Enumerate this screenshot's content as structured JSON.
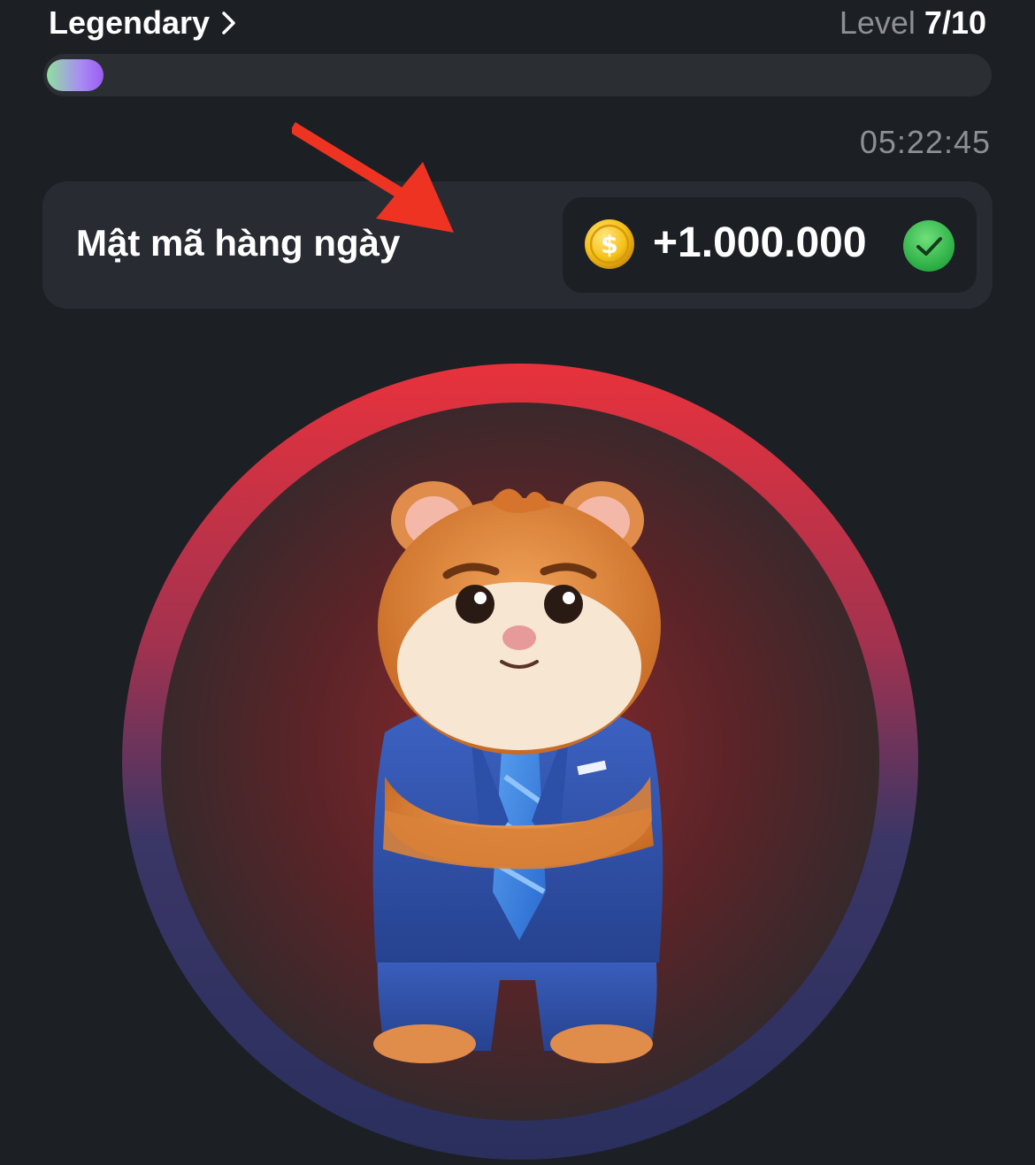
{
  "header": {
    "league": "Legendary",
    "level_label": "Level",
    "level_value": "7/10"
  },
  "progress": {
    "fraction": 0.06,
    "gradient_colors": [
      "#8fe0a0",
      "#a98bf5",
      "#9b5cf2"
    ]
  },
  "timer": "05:22:45",
  "daily_cipher": {
    "title": "Mật mã hàng ngày",
    "reward": "+1.000.000",
    "completed": true,
    "coin_icon": "coin-icon",
    "check_icon": "check-circle-icon"
  },
  "annotation": {
    "arrow_icon": "red-arrow-icon",
    "color": "#ee3322"
  },
  "tap_area": {
    "character_icon": "hamster-ceo-icon",
    "ring_colors": [
      "#e8323c",
      "#2a2f5e"
    ]
  },
  "colors": {
    "background": "#1c1f24",
    "card": "#282b31",
    "muted_text": "#8d8f95"
  }
}
